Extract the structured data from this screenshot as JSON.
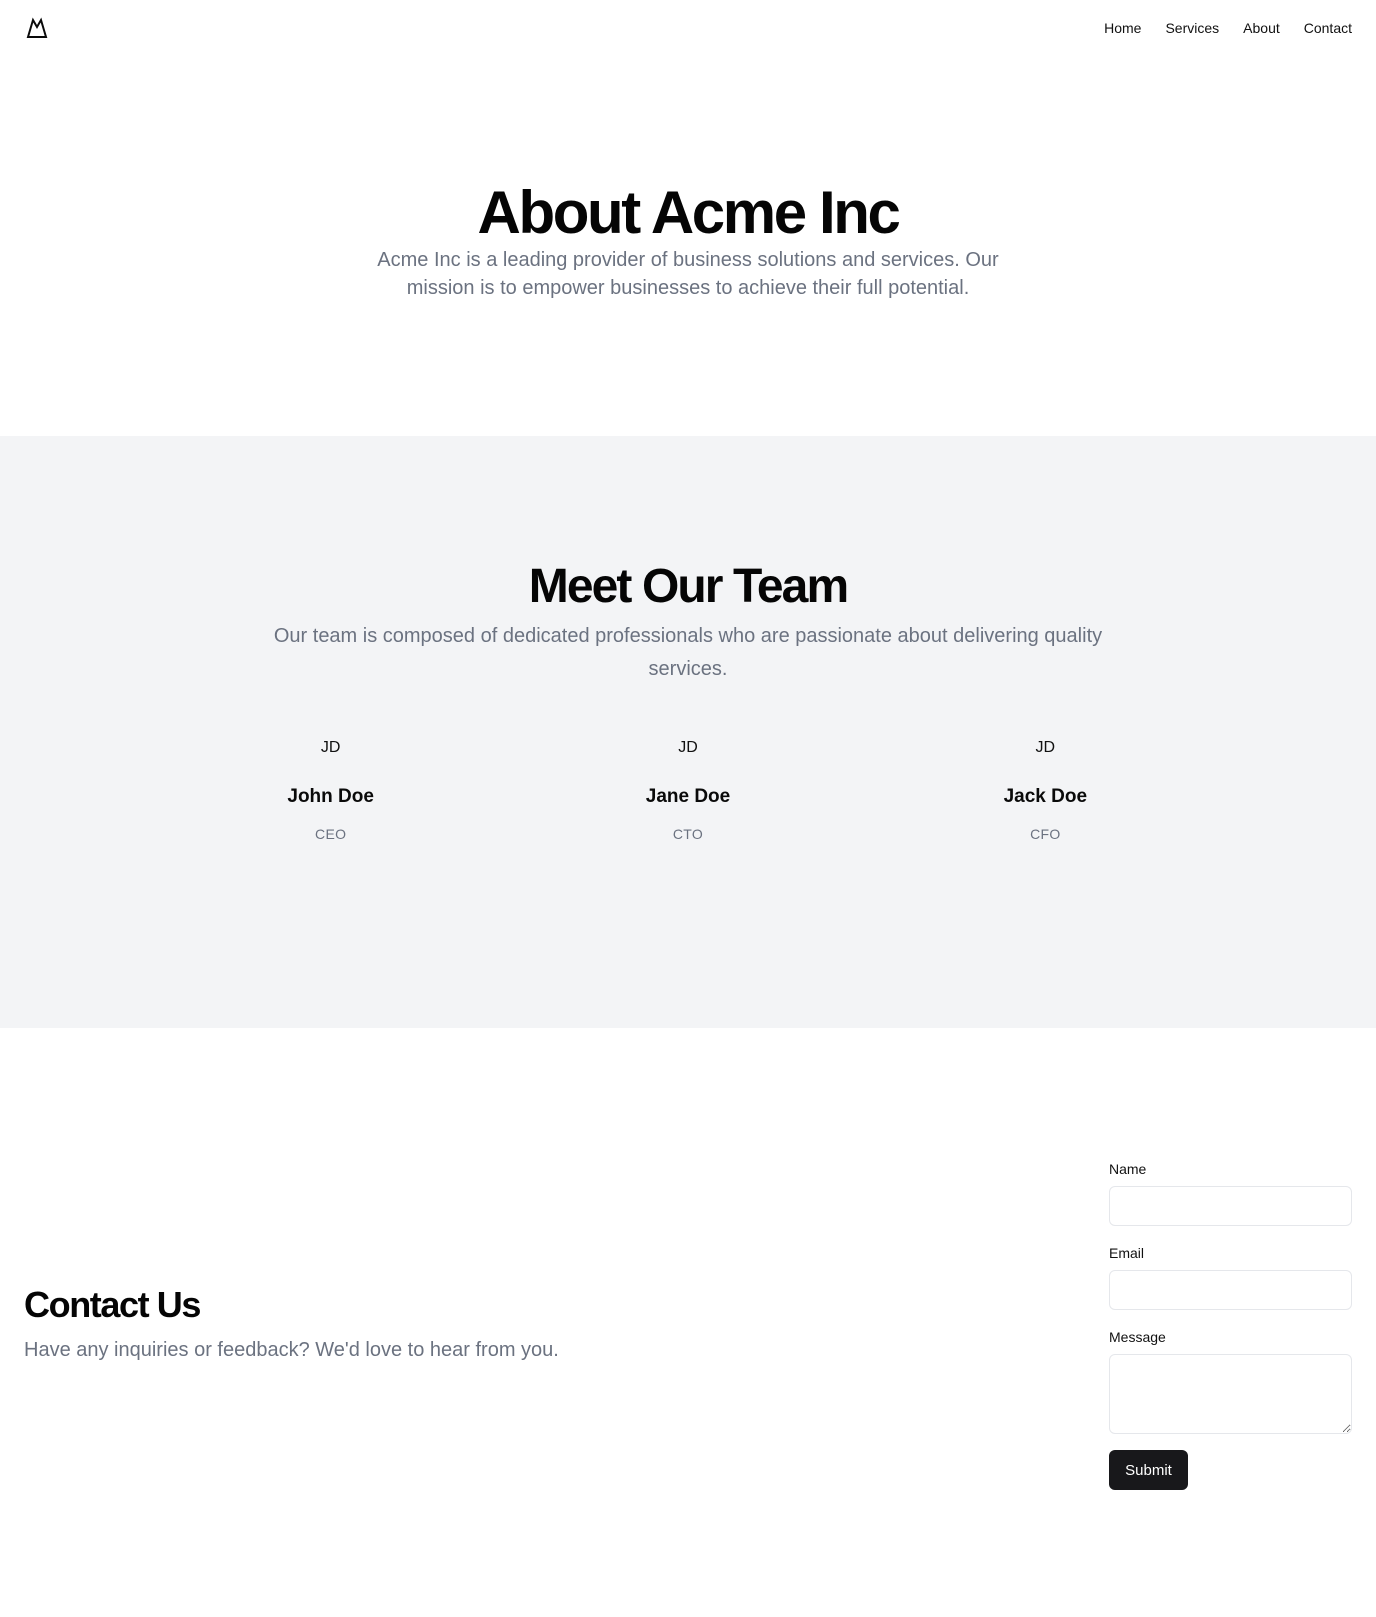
{
  "header": {
    "logo_icon": "mountain-icon",
    "nav": [
      {
        "label": "Home"
      },
      {
        "label": "Services"
      },
      {
        "label": "About"
      },
      {
        "label": "Contact"
      }
    ]
  },
  "hero": {
    "title": "About Acme Inc",
    "description": "Acme Inc is a leading provider of business solutions and services. Our mission is to empower businesses to achieve their full potential."
  },
  "team": {
    "title": "Meet Our Team",
    "description": "Our team is composed of dedicated professionals who are passionate about delivering quality services.",
    "members": [
      {
        "initials": "JD",
        "name": "John Doe",
        "role": "CEO"
      },
      {
        "initials": "JD",
        "name": "Jane Doe",
        "role": "CTO"
      },
      {
        "initials": "JD",
        "name": "Jack Doe",
        "role": "CFO"
      }
    ]
  },
  "contact": {
    "title": "Contact Us",
    "description": "Have any inquiries or feedback? We'd love to hear from you.",
    "form": {
      "name_label": "Name",
      "name_value": "",
      "email_label": "Email",
      "email_value": "",
      "message_label": "Message",
      "message_value": "",
      "submit_label": "Submit"
    }
  },
  "colors": {
    "muted_text": "#6b7280",
    "section_bg": "#f3f4f6",
    "button_bg": "#18181b"
  }
}
